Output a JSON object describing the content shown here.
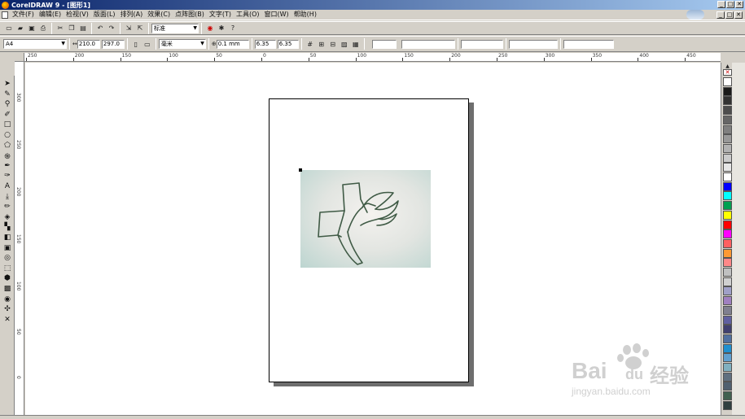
{
  "window": {
    "title": "CorelDRAW 9 - [图形1]",
    "controls": [
      "_",
      "□",
      "✕"
    ]
  },
  "menu": {
    "items": [
      "文件(F)",
      "编辑(E)",
      "检视(V)",
      "版面(L)",
      "排列(A)",
      "效果(C)",
      "点阵图(B)",
      "文字(T)",
      "工具(O)",
      "窗口(W)",
      "帮助(H)"
    ],
    "doc_controls": [
      "_",
      "□",
      "✕"
    ]
  },
  "standard_toolbar": {
    "zoom_value": "标准",
    "zoom_placeholder": ""
  },
  "property_bar": {
    "paper_size": "A4",
    "width_value": "210.0",
    "height_value": "297.0",
    "units": "毫米",
    "nudge": "0.1 mm",
    "dup_x": "6.35",
    "dup_y": "6.35"
  },
  "ruler": {
    "top_labels": [
      "250",
      "200",
      "150",
      "100",
      "50",
      "0",
      "50",
      "100",
      "150",
      "200",
      "250",
      "300",
      "350",
      "400",
      "450"
    ],
    "left_labels": [
      "300",
      "250",
      "200",
      "150",
      "100",
      "50",
      "0"
    ]
  },
  "tools": [
    "pick-tool",
    "shape-tool",
    "zoom-tool",
    "freehand-tool",
    "rectangle-tool",
    "ellipse-tool",
    "polygon-tool",
    "spiral-tool",
    "bezier-tool",
    "artistic-media-tool",
    "text-tool",
    "eyedropper-tool",
    "outline-tool",
    "fill-tool",
    "interactive-fill-tool",
    "transparency-tool",
    "blend-tool",
    "contour-tool",
    "envelope-tool",
    "extrude-tool",
    "shadow-tool",
    "lens-tool",
    "color-tool",
    "x-tool"
  ],
  "palette": [
    "#ffffff",
    "#1a1a1a",
    "#333333",
    "#4d4d4d",
    "#666666",
    "#808080",
    "#999999",
    "#b3b3b3",
    "#cccccc",
    "#e6e6e6",
    "#ffffff",
    "#0000ff",
    "#00ffff",
    "#00a050",
    "#ffff00",
    "#ff0000",
    "#ff00ff",
    "#ff6060",
    "#ff9933",
    "#ff8888",
    "#c0c0c0",
    "#d0d0d0",
    "#a0a0c8",
    "#a080c0",
    "#808090",
    "#6060a0",
    "#404070",
    "#5070a0",
    "#2090d0",
    "#60a0d0",
    "#80b0c0",
    "#607080",
    "#506070",
    "#406050",
    "#304040"
  ],
  "watermark": {
    "brand": "Bai",
    "brand2": "du",
    "cn": "经验",
    "url": "jingyan.baidu.com"
  }
}
